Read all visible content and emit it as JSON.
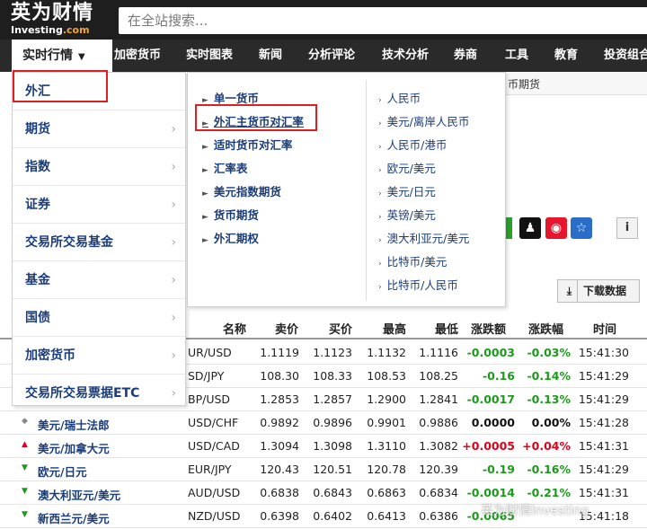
{
  "logo": {
    "cn": "英为财情",
    "en_main": "Investing",
    "en_tld": ".com"
  },
  "search": {
    "placeholder": "在全站搜索..."
  },
  "nav": {
    "active": "实时行情",
    "items": [
      "加密货币",
      "实时图表",
      "新闻",
      "分析评论",
      "技术分析",
      "券商",
      "工具",
      "教育",
      "投资组合"
    ]
  },
  "subbar": {
    "text": "币期货"
  },
  "menu_level1": [
    "外汇",
    "期货",
    "指数",
    "证券",
    "交易所交易基金",
    "基金",
    "国债",
    "加密货币",
    "交易所交易票据ETC"
  ],
  "menu_level2": [
    "单一货币",
    "外汇主货币对汇率",
    "适时货币对汇率",
    "汇率表",
    "美元指数期货",
    "货币期货",
    "外汇期权"
  ],
  "menu_level3": [
    "人民币",
    "美元/离岸人民币",
    "人民币/港币",
    "欧元/美元",
    "美元/日元",
    "英镑/美元",
    "澳大利亚元/美元",
    "比特币/美元",
    "比特币/人民币"
  ],
  "toolbar": {
    "download_label": "下载数据",
    "info_label": "i"
  },
  "table": {
    "headers": [
      "名称",
      "卖价",
      "买价",
      "最高",
      "最低",
      "涨跌额",
      "涨跌幅",
      "时间"
    ],
    "rows": [
      {
        "name": "",
        "symbol": "UR/USD",
        "bid": "1.1119",
        "ask": "1.1123",
        "high": "1.1132",
        "low": "1.1116",
        "chg": "-0.0003",
        "pct": "-0.03%",
        "time": "15:41:30",
        "dir": "down"
      },
      {
        "name": "",
        "symbol": "SD/JPY",
        "bid": "108.30",
        "ask": "108.33",
        "high": "108.53",
        "low": "108.25",
        "chg": "-0.16",
        "pct": "-0.14%",
        "time": "15:41:29",
        "dir": "down"
      },
      {
        "name": "",
        "symbol": "BP/USD",
        "bid": "1.2853",
        "ask": "1.2857",
        "high": "1.2900",
        "low": "1.2841",
        "chg": "-0.0017",
        "pct": "-0.13%",
        "time": "15:41:29",
        "dir": "down"
      },
      {
        "name": "美元/瑞士法郎",
        "symbol": "USD/CHF",
        "bid": "0.9892",
        "ask": "0.9896",
        "high": "0.9901",
        "low": "0.9886",
        "chg": "0.0000",
        "pct": "0.00%",
        "time": "15:41:28",
        "dir": "flat"
      },
      {
        "name": "美元/加拿大元",
        "symbol": "USD/CAD",
        "bid": "1.3094",
        "ask": "1.3098",
        "high": "1.3110",
        "low": "1.3082",
        "chg": "+0.0005",
        "pct": "+0.04%",
        "time": "15:41:31",
        "dir": "up"
      },
      {
        "name": "欧元/日元",
        "symbol": "EUR/JPY",
        "bid": "120.43",
        "ask": "120.51",
        "high": "120.78",
        "low": "120.39",
        "chg": "-0.19",
        "pct": "-0.16%",
        "time": "15:41:29",
        "dir": "down"
      },
      {
        "name": "澳大利亚元/美元",
        "symbol": "AUD/USD",
        "bid": "0.6838",
        "ask": "0.6843",
        "high": "0.6863",
        "low": "0.6834",
        "chg": "-0.0014",
        "pct": "-0.21%",
        "time": "15:41:31",
        "dir": "down"
      },
      {
        "name": "新西兰元/美元",
        "symbol": "NZD/USD",
        "bid": "0.6398",
        "ask": "0.6402",
        "high": "0.6413",
        "low": "0.6386",
        "chg": "-0.0065",
        "pct": "",
        "time": "15:41:18",
        "dir": "down"
      }
    ]
  },
  "colors": {
    "up": "#e0001a",
    "down": "#1a9b1a",
    "link": "#1a3d7a",
    "highlight": "#e02020"
  },
  "watermark": "英为财情Investing"
}
